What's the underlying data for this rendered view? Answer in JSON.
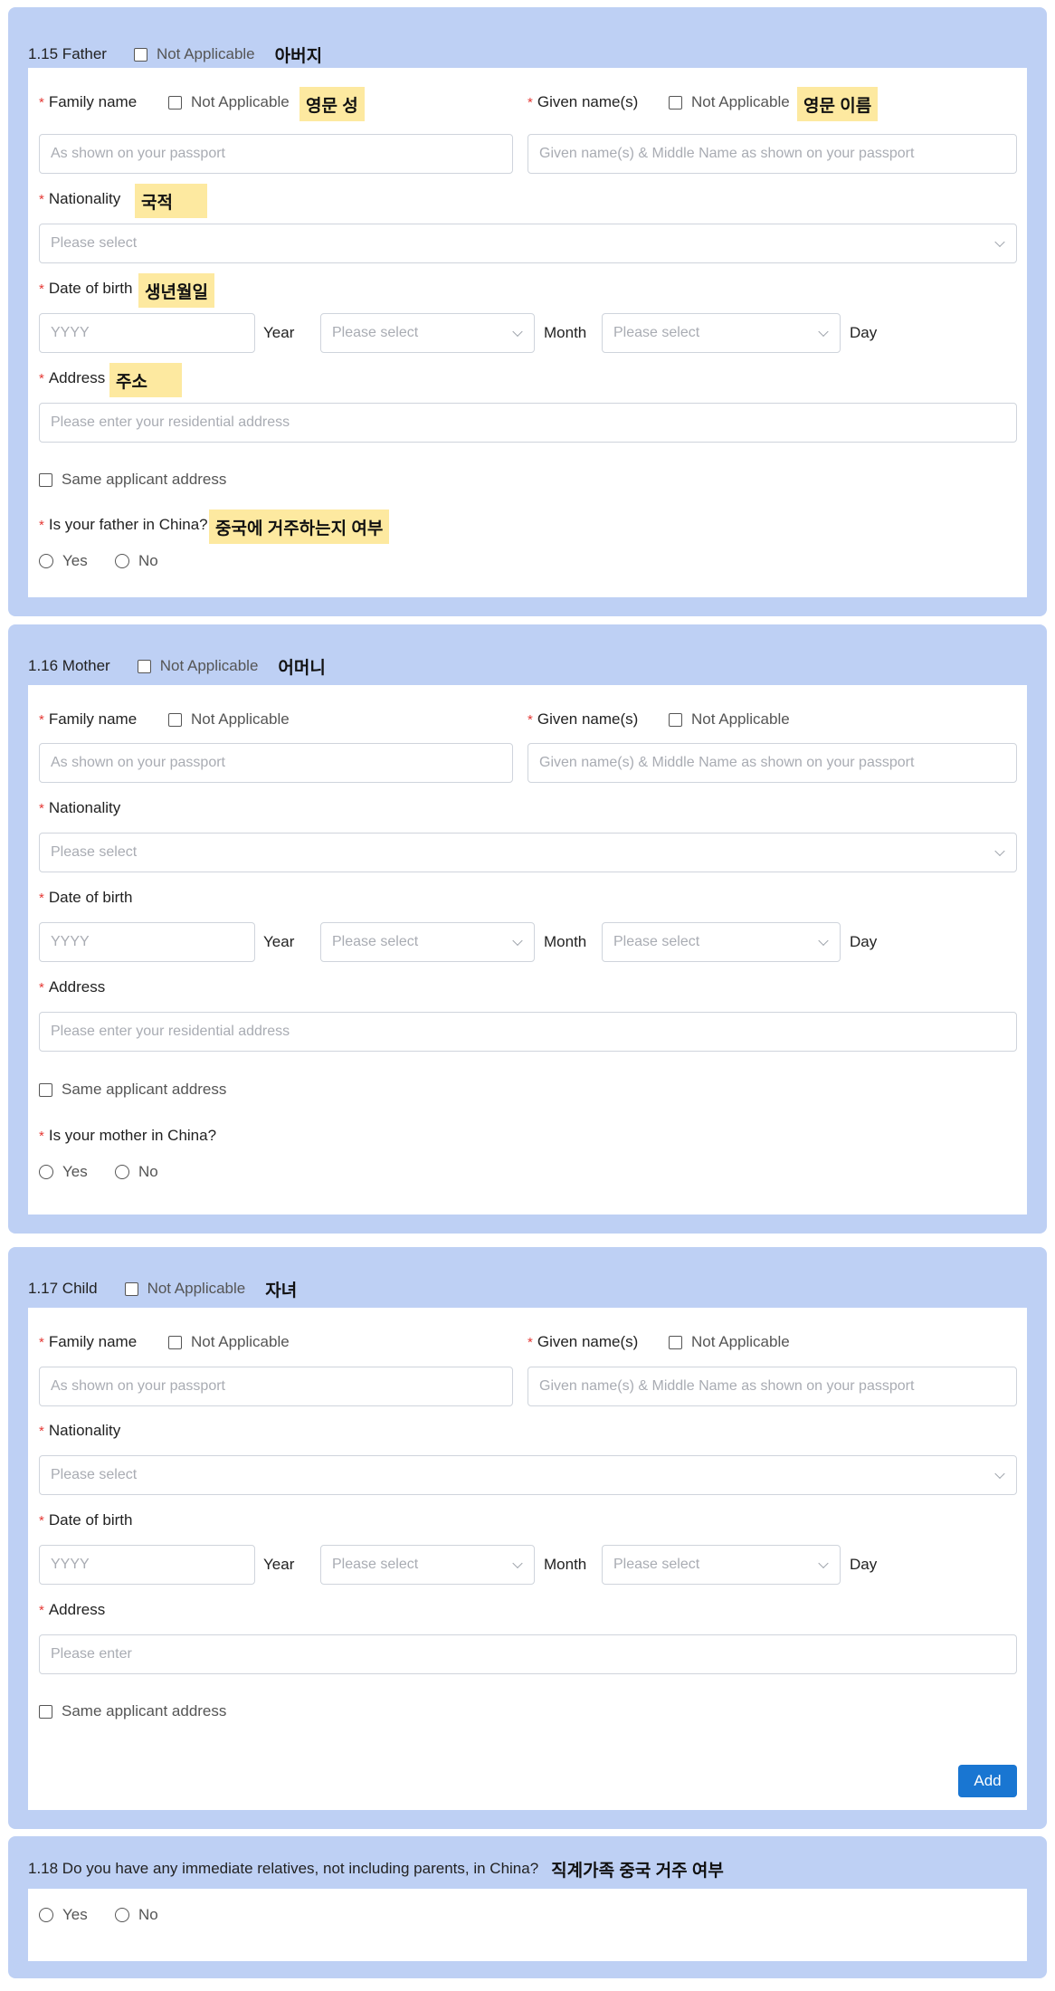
{
  "father": {
    "title": "1.15 Father",
    "not_applicable": "Not Applicable",
    "title_kr": "아버지",
    "family_name": {
      "label": "Family name",
      "na": "Not Applicable",
      "note": "영문 성",
      "placeholder": "As shown on your passport"
    },
    "given_name": {
      "label": "Given name(s)",
      "na": "Not Applicable",
      "note": "영문 이름",
      "placeholder": "Given name(s) & Middle Name as shown on your passport"
    },
    "nationality": {
      "label": "Nationality",
      "note": "국적",
      "placeholder": "Please select"
    },
    "dob": {
      "label": "Date of birth",
      "note": "생년월일",
      "year_placeholder": "YYYY",
      "year": "Year",
      "month_placeholder": "Please select",
      "month": "Month",
      "day_placeholder": "Please select",
      "day": "Day"
    },
    "address": {
      "label": "Address",
      "note": "주소",
      "placeholder": "Please enter your residential address"
    },
    "same_address": "Same applicant address",
    "in_china": {
      "label": "Is your father in China?",
      "note": "중국에 거주하는지 여부",
      "yes": "Yes",
      "no": "No"
    }
  },
  "mother": {
    "title": "1.16 Mother",
    "not_applicable": "Not Applicable",
    "title_kr": "어머니",
    "family_name": {
      "label": "Family name",
      "na": "Not Applicable",
      "placeholder": "As shown on your passport"
    },
    "given_name": {
      "label": "Given name(s)",
      "na": "Not Applicable",
      "placeholder": "Given name(s) & Middle Name as shown on your passport"
    },
    "nationality": {
      "label": "Nationality",
      "placeholder": "Please select"
    },
    "dob": {
      "label": "Date of birth",
      "year_placeholder": "YYYY",
      "year": "Year",
      "month_placeholder": "Please select",
      "month": "Month",
      "day_placeholder": "Please select",
      "day": "Day"
    },
    "address": {
      "label": "Address",
      "placeholder": "Please enter your residential address"
    },
    "same_address": "Same applicant address",
    "in_china": {
      "label": "Is your mother in China?",
      "yes": "Yes",
      "no": "No"
    }
  },
  "child": {
    "title": "1.17 Child",
    "not_applicable": "Not Applicable",
    "title_kr": "자녀",
    "family_name": {
      "label": "Family name",
      "na": "Not Applicable",
      "placeholder": "As shown on your passport"
    },
    "given_name": {
      "label": "Given name(s)",
      "na": "Not Applicable",
      "placeholder": "Given name(s) & Middle Name as shown on your passport"
    },
    "nationality": {
      "label": "Nationality",
      "placeholder": "Please select"
    },
    "dob": {
      "label": "Date of birth",
      "year_placeholder": "YYYY",
      "year": "Year",
      "month_placeholder": "Please select",
      "month": "Month",
      "day_placeholder": "Please select",
      "day": "Day"
    },
    "address": {
      "label": "Address",
      "placeholder": "Please enter"
    },
    "same_address": "Same applicant address",
    "add_button": "Add"
  },
  "relatives": {
    "title": "1.18 Do you have any immediate relatives, not including parents, in China?",
    "title_kr": "직계가족 중국 거주 여부",
    "yes": "Yes",
    "no": "No"
  },
  "colors": {
    "section_bg": "#bed0f4",
    "highlight": "#fde9a0",
    "required": "#e53935",
    "button": "#1976d2"
  }
}
